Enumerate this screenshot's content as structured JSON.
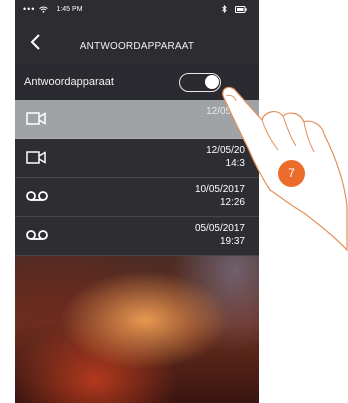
{
  "statusbar": {
    "signal_dots": "•••",
    "time": "1:45 PM"
  },
  "header": {
    "title": "ANTWOORDAPPARAAT"
  },
  "toggle": {
    "label": "Antwoordapparaat",
    "state": "on"
  },
  "messages": [
    {
      "type": "video-icon",
      "date": "12/05/20",
      "time": "1"
    },
    {
      "type": "video-icon",
      "date": "12/05/20",
      "time": "14:3"
    },
    {
      "type": "voicemail-icon",
      "date": "10/05/2017",
      "time": "12:26"
    },
    {
      "type": "voicemail-icon",
      "date": "05/05/2017",
      "time": "19:37"
    }
  ],
  "callout": {
    "step": "7"
  },
  "colors": {
    "accent": "#ec6c2b",
    "header_bg": "#2d2d31",
    "selected_row": "#a0a3a6"
  }
}
